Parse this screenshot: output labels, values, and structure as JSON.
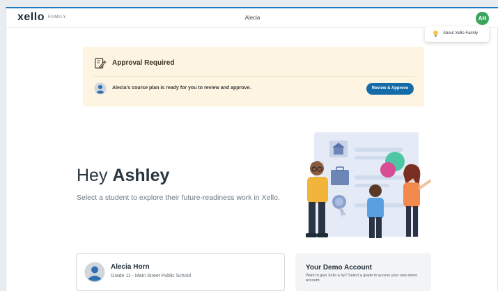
{
  "header": {
    "logo": "xello",
    "logo_sub": "FAMILY",
    "title": "Alecia",
    "avatar_initials": "AH"
  },
  "popover": {
    "icon": "lightbulb-icon",
    "label": "About Xello Family"
  },
  "approval": {
    "icon": "edit-document-icon",
    "title": "Approval Required",
    "message": "Alecia's course plan is ready for you to review and approve.",
    "button_label": "Review & Approve"
  },
  "hero": {
    "greeting": "Hey",
    "name": "Ashley",
    "subtitle": "Select a student to explore their future-readiness work in Xello."
  },
  "student": {
    "name": "Alecia Horn",
    "detail": "Grade 11 - Main Street Public School"
  },
  "demo": {
    "title": "Your Demo Account",
    "text": "Want to give Xello a try? Select a grade to access your own demo account."
  },
  "colors": {
    "accent_blue": "#156ba8",
    "avatar_green": "#3aa55d",
    "approval_bg": "#fdf5e2"
  }
}
